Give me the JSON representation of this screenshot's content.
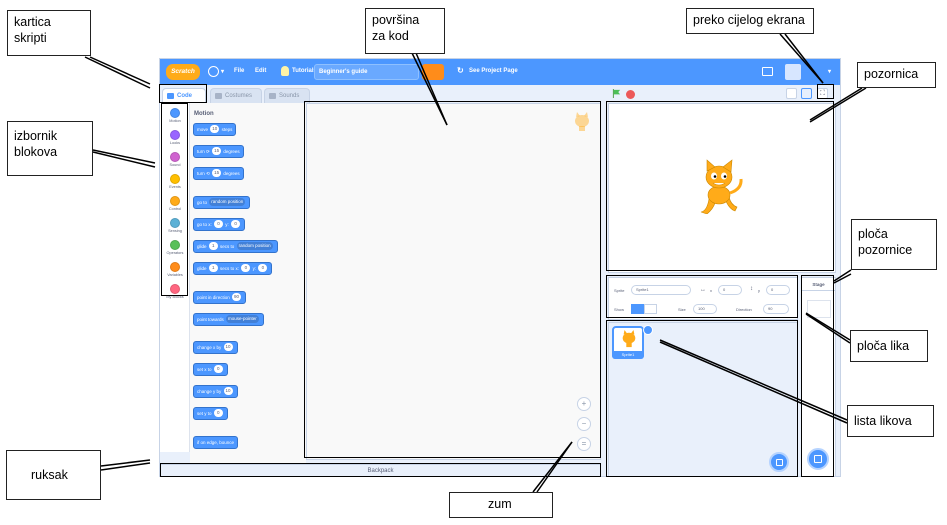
{
  "menubar": {
    "logo": "Scratch",
    "file": "File",
    "edit": "Edit",
    "tutorials": "Tutorials",
    "project_title": "Beginner's guide",
    "see_project_page": "See Project Page"
  },
  "tabs": [
    {
      "label": "Code",
      "icon": "code-icon"
    },
    {
      "label": "Costumes",
      "icon": "brush-icon"
    },
    {
      "label": "Sounds",
      "icon": "speaker-icon"
    }
  ],
  "categories": [
    {
      "label": "Motion",
      "color": "#4c97ff"
    },
    {
      "label": "Looks",
      "color": "#9966ff"
    },
    {
      "label": "Sound",
      "color": "#cf63cf"
    },
    {
      "label": "Events",
      "color": "#ffbf00"
    },
    {
      "label": "Control",
      "color": "#ffab19"
    },
    {
      "label": "Sensing",
      "color": "#5cb1d6"
    },
    {
      "label": "Operators",
      "color": "#59c059"
    },
    {
      "label": "Variables",
      "color": "#ff8c1a"
    },
    {
      "label": "My Blocks",
      "color": "#ff6680"
    }
  ],
  "palette": {
    "title": "Motion",
    "blocks": {
      "move": {
        "a": "move",
        "v1": "10",
        "b": "steps"
      },
      "turn_right": {
        "a": "turn",
        "icon": "rotate-right-icon",
        "v1": "15",
        "b": "degrees"
      },
      "turn_left": {
        "a": "turn",
        "icon": "rotate-left-icon",
        "v1": "15",
        "b": "degrees"
      },
      "goto": {
        "a": "go to",
        "dd": "random position"
      },
      "goto_xy": {
        "a": "go to x:",
        "v1": "0",
        "b": "y:",
        "v2": "0"
      },
      "glide": {
        "a": "glide",
        "v1": "1",
        "b": "secs to",
        "dd": "random position"
      },
      "glide_xy": {
        "a": "glide",
        "v1": "1",
        "b": "secs to x:",
        "v2": "0",
        "c": "y:",
        "v3": "0"
      },
      "point_dir": {
        "a": "point in direction",
        "v1": "90"
      },
      "point_towards": {
        "a": "point towards",
        "dd": "mouse-pointer"
      },
      "change_x": {
        "a": "change x by",
        "v1": "10"
      },
      "set_x": {
        "a": "set x to",
        "v1": "0"
      },
      "change_y": {
        "a": "change y by",
        "v1": "10"
      },
      "set_y": {
        "a": "set y to",
        "v1": "0"
      },
      "bounce": {
        "a": "if on edge, bounce"
      }
    }
  },
  "backpack": "Backpack",
  "sprite_info": {
    "sprite_label": "Sprite",
    "sprite_name": "Sprite1",
    "x_label": "x",
    "x_value": "0",
    "y_label": "y",
    "y_value": "0",
    "show_label": "Show",
    "size_label": "Size",
    "size_value": "100",
    "direction_label": "Direction",
    "direction_value": "90"
  },
  "sprite_list": {
    "sprite_name": "Sprite1"
  },
  "stage_pane": {
    "title": "Stage"
  },
  "annotations": {
    "kartica_skripti": [
      "kartica",
      "skripti"
    ],
    "povrsina_za_kod": [
      "površina",
      "za kod"
    ],
    "preko_cijelog_ekrana": "preko cijelog ekrana",
    "pozornica": "pozornica",
    "izbornik_blokova": [
      "izbornik",
      "blokova"
    ],
    "ploca_pozornice": [
      "ploča",
      "pozornice"
    ],
    "ploca_lika": "ploča lika",
    "lista_likova": "lista likova",
    "ruksak": "ruksak",
    "zum": "zum"
  }
}
